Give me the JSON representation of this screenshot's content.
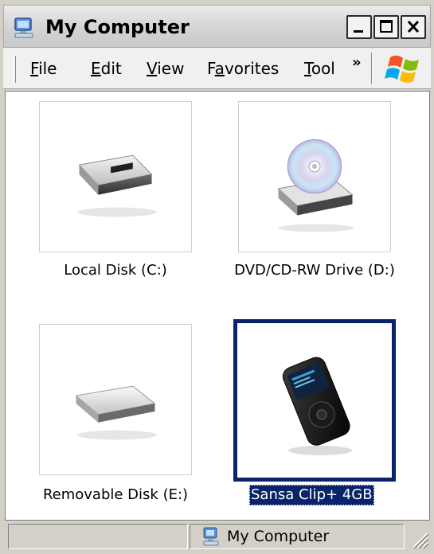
{
  "window": {
    "title": "My Computer"
  },
  "menu": {
    "items": [
      {
        "accel": "F",
        "rest": "ile"
      },
      {
        "accel": "E",
        "rest": "dit"
      },
      {
        "accel": "V",
        "rest": "iew"
      },
      {
        "pre": "F",
        "accel": "a",
        "rest": "vorites"
      },
      {
        "accel": "T",
        "rest": "ool"
      }
    ],
    "overflow": "»"
  },
  "drives": [
    {
      "label": "Local Disk (C:)",
      "icon": "hard-disk-icon",
      "selected": false
    },
    {
      "label": "DVD/CD-RW Drive (D:)",
      "icon": "dvd-drive-icon",
      "selected": false
    },
    {
      "label": "Removable Disk (E:)",
      "icon": "removable-disk-icon",
      "selected": false
    },
    {
      "label": "Sansa Clip+ 4GB",
      "icon": "mp3-player-icon",
      "selected": true
    }
  ],
  "status": {
    "location": "My Computer"
  },
  "colors": {
    "selection": "#0a246a",
    "chrome": "#d4d0c8"
  }
}
